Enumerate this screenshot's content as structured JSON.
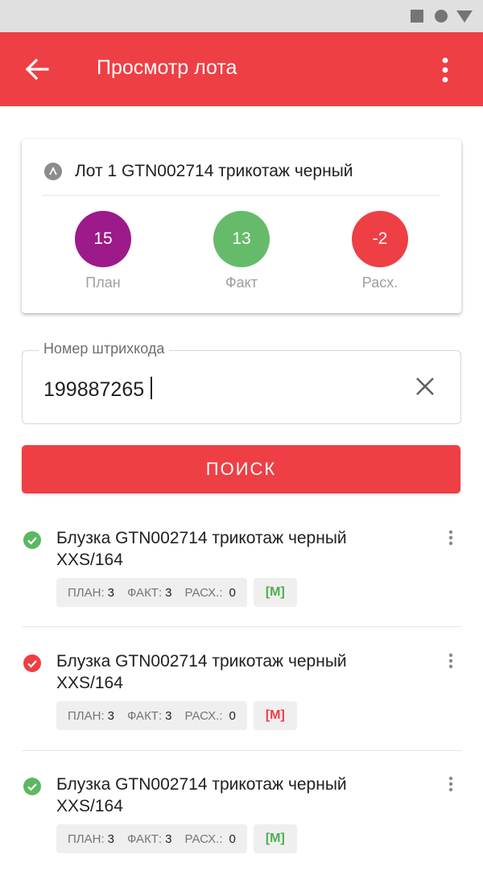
{
  "app_bar": {
    "title": "Просмотр лота",
    "back_icon": "arrow-back-icon",
    "menu_icon": "more-vert-icon",
    "color": "#ee3f45"
  },
  "lot": {
    "title": "Лот 1 GTN002714 трикотаж черный",
    "stats": [
      {
        "value": "15",
        "label": "План",
        "color": "#9c1a8a"
      },
      {
        "value": "13",
        "label": "Факт",
        "color": "#66bb6a"
      },
      {
        "value": "-2",
        "label": "Расх.",
        "color": "#ee3f45"
      }
    ]
  },
  "barcode": {
    "label": "Номер штрихкода",
    "value": "199887265"
  },
  "search_button": {
    "label": "ПОИСК"
  },
  "items": [
    {
      "title": "Блузка GTN002714 трикотаж черный XXS/164",
      "status": "ok",
      "status_color": "#5cb860",
      "plan_label": "ПЛАН:",
      "plan": "3",
      "fact_label": "ФАКТ:",
      "fact": "3",
      "diff_label": "РАСХ.:",
      "diff": "0",
      "marker": "[М]",
      "marker_color": "#4caf50"
    },
    {
      "title": "Блузка GTN002714 трикотаж черный XXS/164",
      "status": "error",
      "status_color": "#ee3f45",
      "plan_label": "ПЛАН:",
      "plan": "3",
      "fact_label": "ФАКТ:",
      "fact": "3",
      "diff_label": "РАСХ.:",
      "diff": "0",
      "marker": "[М]",
      "marker_color": "#ee3f45"
    },
    {
      "title": "Блузка GTN002714 трикотаж черный XXS/164",
      "status": "ok",
      "status_color": "#5cb860",
      "plan_label": "ПЛАН:",
      "plan": "3",
      "fact_label": "ФАКТ:",
      "fact": "3",
      "diff_label": "РАСХ.:",
      "diff": "0",
      "marker": "[М]",
      "marker_color": "#4caf50"
    }
  ]
}
